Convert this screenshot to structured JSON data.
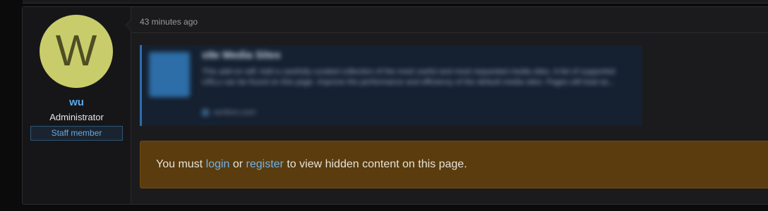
{
  "post": {
    "author": {
      "avatar_letter": "W",
      "avatar_color": "#c9cc6a",
      "username": "wu",
      "title": "Administrator",
      "badge": "Staff member"
    },
    "timestamp": "43 minutes ago",
    "unfurl": {
      "title": "s9e Media Sites",
      "description": "This add-on will: Add a carefully curated collection of the most useful and most requested media sites. A list of supported URLs can be found on this page. Improve the performance and efficiency of the default media sites. Pages will load as...",
      "domain": "xenforo.com",
      "accent_color": "#2c6db0"
    },
    "hidden_notice": {
      "prefix": "You must",
      "login_link": "login",
      "middle": "or",
      "register_link": "register",
      "suffix": "to view hidden content on this page.",
      "background_color": "#5a3c0f"
    }
  }
}
